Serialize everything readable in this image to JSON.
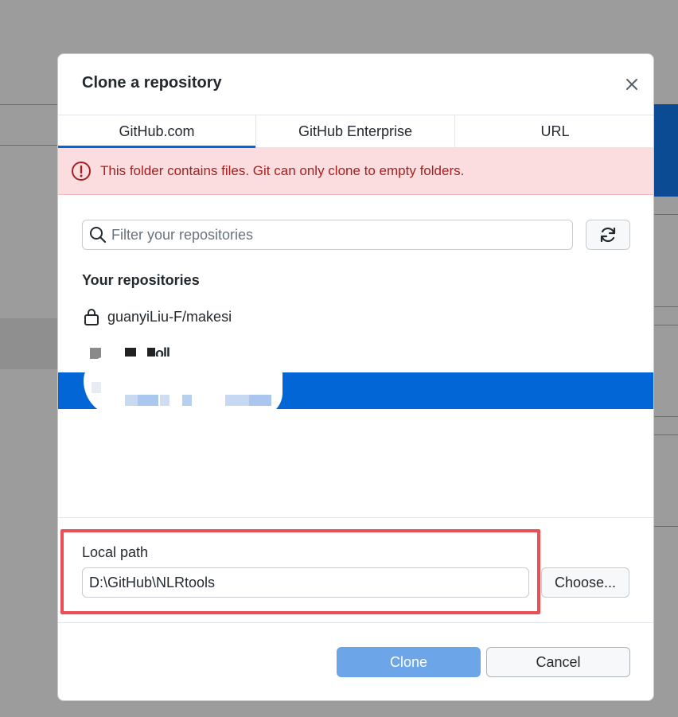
{
  "dialog": {
    "title": "Clone a repository",
    "close_icon": "close-icon"
  },
  "tabs": [
    {
      "label": "GitHub.com",
      "active": true
    },
    {
      "label": "GitHub Enterprise",
      "active": false
    },
    {
      "label": "URL",
      "active": false
    }
  ],
  "error": {
    "icon": "alert-circle-icon",
    "message": "This folder contains files. Git can only clone to empty folders."
  },
  "filter": {
    "placeholder": "Filter your repositories",
    "value": "",
    "search_icon": "search-icon",
    "refresh_icon": "refresh-icon"
  },
  "repositories": {
    "heading": "Your repositories",
    "items": [
      {
        "name": "guanyiLiu-F/makesi",
        "private": true,
        "selected": false
      },
      {
        "name": "oll",
        "private": false,
        "selected": false,
        "redacted": true
      },
      {
        "name": "",
        "private": false,
        "selected": true,
        "redacted": true
      }
    ]
  },
  "local_path": {
    "label": "Local path",
    "value": "D:\\GitHub\\NLRtools",
    "choose_label": "Choose..."
  },
  "footer": {
    "clone_label": "Clone",
    "cancel_label": "Cancel"
  },
  "colors": {
    "accent": "#0366d6",
    "error_bg": "#fbdde0",
    "error_text": "#a7201f",
    "highlight": "#ea4f55",
    "clone_disabled": "#6da6e8"
  }
}
